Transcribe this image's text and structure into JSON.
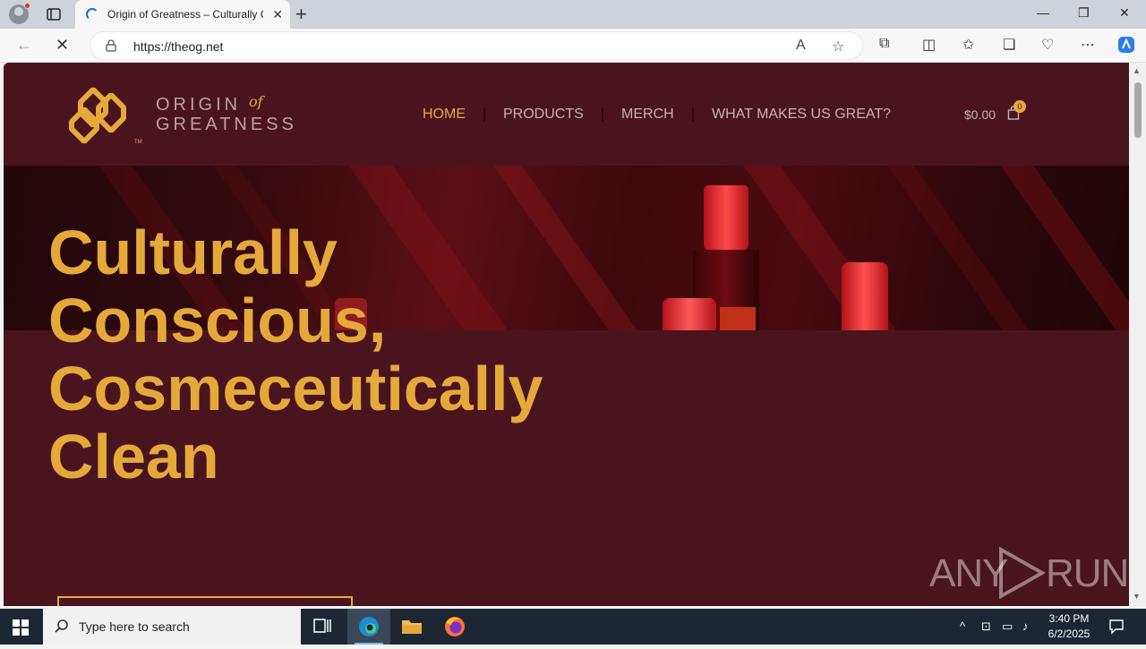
{
  "browser": {
    "tab_title": "Origin of Greatness – Culturally C",
    "url": "https://theog.net"
  },
  "site": {
    "brand_line1": "ORIGIN",
    "brand_of": "of",
    "brand_line2": "GREATNESS",
    "brand_tm": "TM",
    "nav": [
      {
        "label": "HOME",
        "active": true
      },
      {
        "label": "PRODUCTS"
      },
      {
        "label": "MERCH"
      },
      {
        "label": "WHAT MAKES US GREAT?"
      }
    ],
    "cart_total": "$0.00",
    "cart_count": "0",
    "hero_lines": [
      "Culturally",
      "Conscious,",
      "Cosmeceutically",
      "Clean"
    ],
    "accent_color": "#e5a93a",
    "background_color": "#4a141f"
  },
  "watermark": {
    "left": "ANY",
    "right": "RUN"
  },
  "taskbar": {
    "search_placeholder": "Type here to search",
    "time": "3:40 PM",
    "date": "6/2/2025"
  }
}
